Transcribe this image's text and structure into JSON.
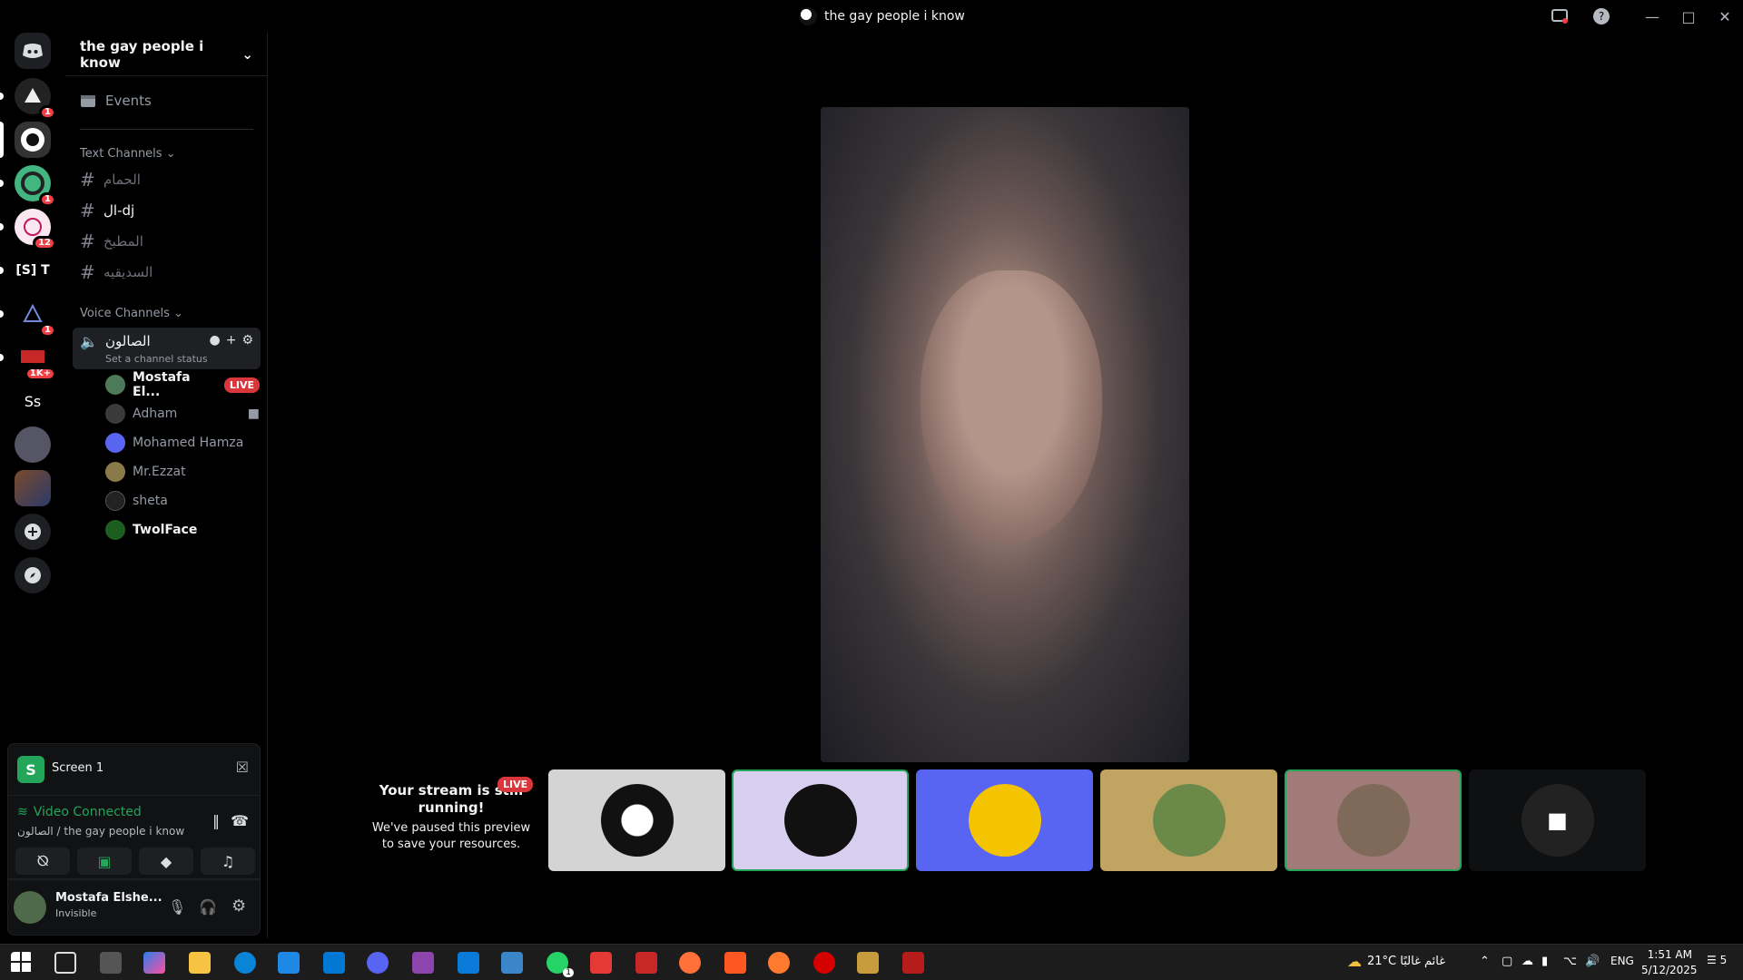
{
  "window": {
    "title": "the gay people i know"
  },
  "servers": [
    {
      "badge": "1"
    },
    {
      "badge": ""
    },
    {
      "badge": "1"
    },
    {
      "badge": "12"
    },
    {
      "label": "[S] T",
      "badge": ""
    },
    {
      "badge": "1"
    },
    {
      "badge": "1K+"
    },
    {
      "label": "Ss",
      "badge": ""
    },
    {
      "badge": ""
    },
    {
      "badge": ""
    }
  ],
  "sidebar": {
    "guild_name": "the gay people i know",
    "events_label": "Events",
    "text_category": "Text Channels",
    "text_channels": [
      "الحمام",
      "ال-dj",
      "المطبخ",
      "السديقيه"
    ],
    "voice_category": "Voice Channels",
    "voice_channel": {
      "name": "الصالون",
      "status": "Set a channel status"
    },
    "members": [
      {
        "name": "Mostafa El...",
        "live": "LIVE"
      },
      {
        "name": "Adham"
      },
      {
        "name": "Mohamed Hamza"
      },
      {
        "name": "Mr.Ezzat"
      },
      {
        "name": "sheta"
      },
      {
        "name": "TwolFace"
      }
    ]
  },
  "screen_panel": {
    "label": "Screen 1"
  },
  "rtc": {
    "status": "Video Connected",
    "location": "الصالون / the gay people i know"
  },
  "user": {
    "name": "Mostafa Elshe...",
    "status": "Invisible"
  },
  "stage": {
    "notice_title": "Your stream is still running!",
    "notice_body": "We've paused this preview to save your resources.",
    "notice_badge": "LIVE"
  },
  "taskbar": {
    "weather": "21°C غائم غالبًا",
    "lang": "ENG",
    "time": "1:51 AM",
    "date": "5/12/2025",
    "notifications": "5",
    "whatsapp_badge": "1"
  }
}
